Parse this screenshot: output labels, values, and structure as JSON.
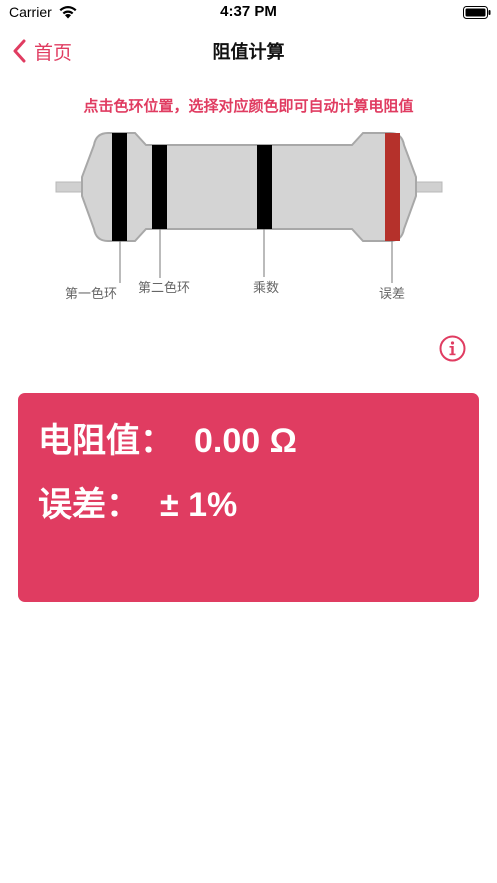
{
  "status_bar": {
    "carrier": "Carrier",
    "time": "4:37 PM"
  },
  "nav": {
    "back_label": "首页",
    "title": "阻值计算"
  },
  "instruction": "点击色环位置，选择对应颜色即可自动计算电阻值",
  "resistor": {
    "band_labels": {
      "first": "第一色环",
      "second": "第二色环",
      "multiplier": "乘数",
      "tolerance": "误差"
    },
    "band_colors": {
      "first": "#000000",
      "second": "#000000",
      "multiplier": "#000000",
      "tolerance": "#b5312b"
    },
    "body_color": "#d4d4d4"
  },
  "result": {
    "resistance_label": "电阻值：",
    "resistance_value": "0.00 Ω",
    "tolerance_label": "误差：",
    "tolerance_value": "± 1%"
  },
  "colors": {
    "accent": "#e03c61"
  }
}
